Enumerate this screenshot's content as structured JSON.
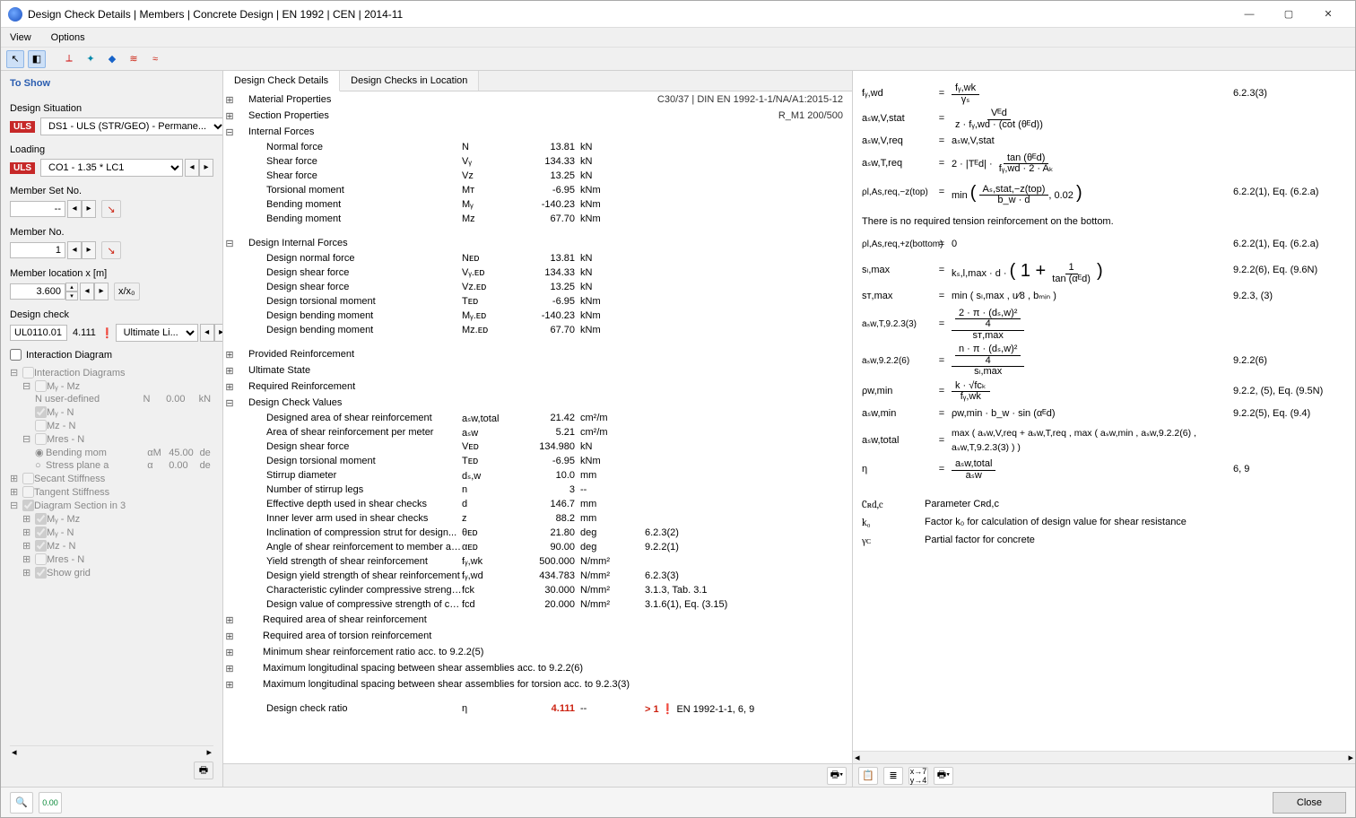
{
  "window": {
    "title": "Design Check Details | Members | Concrete Design | EN 1992 | CEN | 2014-11"
  },
  "menu": {
    "view": "View",
    "options": "Options"
  },
  "left": {
    "to_show": "To Show",
    "design_situation_lbl": "Design Situation",
    "design_situation_val": "DS1 - ULS (STR/GEO) - Permane...",
    "uls": "ULS",
    "loading_lbl": "Loading",
    "loading_val": "CO1 - 1.35 * LC1",
    "memberset_lbl": "Member Set No.",
    "memberset_val": "--",
    "memberno_lbl": "Member No.",
    "memberno_val": "1",
    "location_lbl": "Member location x [m]",
    "location_val": "3.600",
    "xx0": "x/x₀",
    "design_check_lbl": "Design check",
    "design_check_code": "UL0110.01",
    "design_check_ratio": "4.111",
    "design_check_type": "Ultimate Li...",
    "interaction_lbl": "Interaction Diagram",
    "tree": {
      "t1": "Interaction Diagrams",
      "r1": "Mᵧ - Mz",
      "r2": "N user-defined",
      "r2v2": "N",
      "r2v3": "0.00",
      "r2v4": "kN",
      "r3": "Mᵧ - N",
      "r4": "Mz - N",
      "r5": "Mres - N",
      "r6": "Bending mom",
      "r6v2": "αM",
      "r6v3": "45.00",
      "r6v4": "de",
      "r7": "Stress plane a",
      "r7v2": "α",
      "r7v3": "0.00",
      "r7v4": "de",
      "t2": "Secant Stiffness",
      "t3": "Tangent Stiffness",
      "t4": "Diagram Section in 3",
      "d1": "Mᵧ - Mz",
      "d2": "Mᵧ - N",
      "d3": "Mz - N",
      "d4": "Mres - N",
      "d5": "Show grid"
    }
  },
  "tabs": {
    "t1": "Design Check Details",
    "t2": "Design Checks in Location"
  },
  "mid": {
    "matprop": "Material Properties",
    "matprop_r": "C30/37 | DIN EN 1992-1-1/NA/A1:2015-12",
    "secprop": "Section Properties",
    "secprop_r": "R_M1 200/500",
    "intforces": "Internal Forces",
    "if": [
      {
        "n": "Normal force",
        "s": "N",
        "v": "13.81",
        "u": "kN"
      },
      {
        "n": "Shear force",
        "s": "Vᵧ",
        "v": "134.33",
        "u": "kN"
      },
      {
        "n": "Shear force",
        "s": "Vz",
        "v": "13.25",
        "u": "kN"
      },
      {
        "n": "Torsional moment",
        "s": "Mᴛ",
        "v": "-6.95",
        "u": "kNm"
      },
      {
        "n": "Bending moment",
        "s": "Mᵧ",
        "v": "-140.23",
        "u": "kNm"
      },
      {
        "n": "Bending moment",
        "s": "Mz",
        "v": "67.70",
        "u": "kNm"
      }
    ],
    "dintforces": "Design Internal Forces",
    "dif": [
      {
        "n": "Design normal force",
        "s": "Nᴇᴅ",
        "v": "13.81",
        "u": "kN"
      },
      {
        "n": "Design shear force",
        "s": "Vᵧ.ᴇᴅ",
        "v": "134.33",
        "u": "kN"
      },
      {
        "n": "Design shear force",
        "s": "Vz.ᴇᴅ",
        "v": "13.25",
        "u": "kN"
      },
      {
        "n": "Design torsional moment",
        "s": "Tᴇᴅ",
        "v": "-6.95",
        "u": "kNm"
      },
      {
        "n": "Design bending moment",
        "s": "Mᵧ.ᴇᴅ",
        "v": "-140.23",
        "u": "kNm"
      },
      {
        "n": "Design bending moment",
        "s": "Mz.ᴇᴅ",
        "v": "67.70",
        "u": "kNm"
      }
    ],
    "prov_reinf": "Provided Reinforcement",
    "ult_state": "Ultimate State",
    "req_reinf": "Required Reinforcement",
    "dcvals": "Design Check Values",
    "dcv": [
      {
        "n": "Designed area of shear reinforcement",
        "s": "aₛw,total",
        "v": "21.42",
        "u": "cm²/m"
      },
      {
        "n": "Area of shear reinforcement per meter",
        "s": "aₛw",
        "v": "5.21",
        "u": "cm²/m"
      },
      {
        "n": "Design shear force",
        "s": "Vᴇᴅ",
        "v": "134.980",
        "u": "kN"
      },
      {
        "n": "Design torsional moment",
        "s": "Tᴇᴅ",
        "v": "-6.95",
        "u": "kNm"
      },
      {
        "n": "Stirrup diameter",
        "s": "dₛ,w",
        "v": "10.0",
        "u": "mm"
      },
      {
        "n": "Number of stirrup legs",
        "s": "n",
        "v": "3",
        "u": "--"
      },
      {
        "n": "Effective depth used in shear checks",
        "s": "d",
        "v": "146.7",
        "u": "mm"
      },
      {
        "n": "Inner lever arm used in shear checks",
        "s": "z",
        "v": "88.2",
        "u": "mm"
      },
      {
        "n": "Inclination of compression strut for design...",
        "s": "θᴇᴅ",
        "v": "21.80",
        "u": "deg",
        "note": "6.2.3(2)"
      },
      {
        "n": "Angle of shear reinforcement to member axis",
        "s": "αᴇᴅ",
        "v": "90.00",
        "u": "deg",
        "note": "9.2.2(1)"
      },
      {
        "n": "Yield strength of shear reinforcement",
        "s": "fᵧ,wk",
        "v": "500.000",
        "u": "N/mm²"
      },
      {
        "n": "Design yield strength of shear reinforcement",
        "s": "fᵧ,wd",
        "v": "434.783",
        "u": "N/mm²",
        "note": "6.2.3(3)"
      },
      {
        "n": "Characteristic cylinder compressive strengt...",
        "s": "fck",
        "v": "30.000",
        "u": "N/mm²",
        "note": "3.1.3, Tab. 3.1"
      },
      {
        "n": "Design value of compressive strength of co...",
        "s": "fcd",
        "v": "20.000",
        "u": "N/mm²",
        "note": "3.1.6(1), Eq. (3.15)"
      }
    ],
    "req_shear": "Required area of shear reinforcement",
    "req_torsion": "Required area of torsion reinforcement",
    "min_shear": "Minimum shear reinforcement ratio acc. to 9.2.2(5)",
    "max_long1": "Maximum longitudinal spacing between shear assemblies acc. to 9.2.2(6)",
    "max_long2": "Maximum longitudinal spacing between shear assemblies for torsion acc. to 9.2.3(3)",
    "ratio_lbl": "Design check ratio",
    "ratio_s": "η",
    "ratio_v": "4.111",
    "ratio_u": "--",
    "ratio_note1": "> 1",
    "ratio_note2": "EN 1992-1-1, 6, 9"
  },
  "right": {
    "f1": {
      "lhs": "fᵧ,wd",
      "rhs_n": "fᵧ,wk",
      "rhs_d": "γₛ",
      "ref": "6.2.3(3)"
    },
    "f2": {
      "lhs": "aₛw,V,stat",
      "rhs_n": "Vᴱd",
      "rhs_d": "z · fᵧ,wd · (cot (θᴱd))"
    },
    "f3": {
      "lhs": "aₛw,V,req",
      "rhs": "aₛw,V,stat"
    },
    "f4": {
      "lhs": "aₛw,T,req",
      "rhs_pre": "2 · |Tᴱd| ·",
      "rhs_n": "tan (θᴱd)",
      "rhs_d": "fᵧ,wd · 2 · Aₖ"
    },
    "f5": {
      "lhs": "ρl,As,req,−z(top)",
      "rhs_pre": "min",
      "rhs_n": "Aₛ,stat,−z(top)",
      "rhs_d": "b_w · d",
      "rhs_post": ", 0.02",
      "ref": "6.2.2(1), Eq. (6.2.a)"
    },
    "note": "There is no required tension reinforcement on the bottom.",
    "f6": {
      "lhs": "ρl,As,req,+z(bottom)",
      "rhs": "0",
      "ref": "6.2.2(1), Eq. (6.2.a)"
    },
    "f7": {
      "lhs": "sₗ,max",
      "rhs_pre": "kₛ,l,max · d ·",
      "rhs_n": "1",
      "rhs_d": "tan (αᴱd)",
      "rhs_wrap": "( 1 +",
      "rhs_close": ")",
      "ref": "9.2.2(6), Eq. (9.6N)"
    },
    "f8": {
      "lhs": "sᴛ,max",
      "rhs_pre": "min",
      "rhs_args": "( sₗ,max ,  u⁄8 ,  bₘᵢₙ )",
      "ref": "9.2.3, (3)"
    },
    "f9": {
      "lhs": "aₛw,T,9.2.3(3)",
      "rhs1_n": "2 · π · (dₛ,w)²",
      "rhs1_d": "4",
      "rhs2": "sᴛ,max"
    },
    "f10": {
      "lhs": "aₛw,9.2.2(6)",
      "rhs1_n": "n · π · (dₛ,w)²",
      "rhs1_d": "4",
      "rhs2": "sₗ,max",
      "ref": "9.2.2(6)"
    },
    "f11": {
      "lhs": "ρw,min",
      "rhs_n": "k · √fcₖ",
      "rhs_d": "fᵧ,wk",
      "ref": "9.2.2, (5), Eq. (9.5N)"
    },
    "f12": {
      "lhs": "aₛw,min",
      "rhs": "ρw,min · b_w · sin (αᴱd)",
      "ref": "9.2.2(5), Eq. (9.4)"
    },
    "f13": {
      "lhs": "aₛw,total",
      "rhs": "max ( aₛw,V,req + aₛw,T,req , max ( aₛw,min , aₛw,9.2.2(6) , aₛw,T,9.2.3(3) ) )"
    },
    "f14": {
      "lhs": "η",
      "rhs_n": "aₛw,total",
      "rhs_d": "aₛw",
      "ref": "6, 9"
    },
    "params": [
      {
        "s": "Cʀd,c",
        "d": "Parameter Cʀd,c"
      },
      {
        "s": "k₀",
        "d": "Factor k₀ for calculation of design value for shear resistance"
      },
      {
        "s": "γᴄ",
        "d": "Partial factor for concrete"
      }
    ]
  },
  "footer": {
    "close": "Close"
  }
}
